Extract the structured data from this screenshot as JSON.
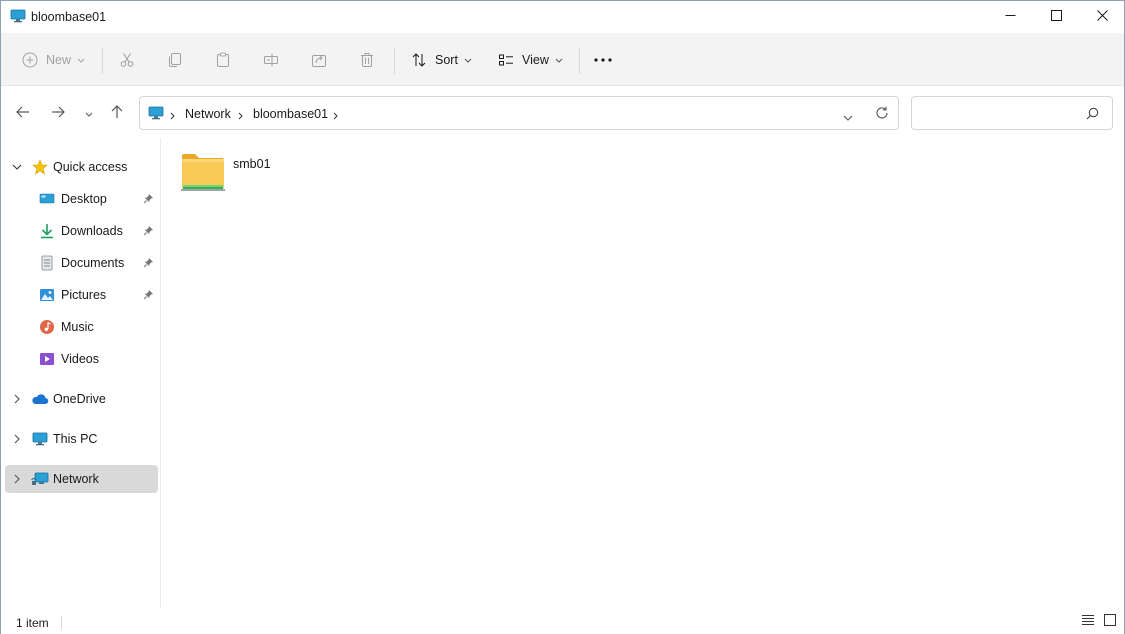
{
  "window": {
    "title": "bloombase01",
    "minimize_label": "Minimize",
    "maximize_label": "Maximize",
    "close_label": "Close"
  },
  "toolbar": {
    "new_label": "New",
    "sort_label": "Sort",
    "view_label": "View",
    "more_glyph": "···"
  },
  "address": {
    "breadcrumbs": [
      "Network",
      "bloombase01"
    ],
    "search_placeholder": ""
  },
  "sidebar": {
    "quick_access": "Quick access",
    "pinned": [
      {
        "label": "Desktop",
        "icon": "desktop-icon"
      },
      {
        "label": "Downloads",
        "icon": "downloads-icon"
      },
      {
        "label": "Documents",
        "icon": "documents-icon"
      },
      {
        "label": "Pictures",
        "icon": "pictures-icon"
      },
      {
        "label": "Music",
        "icon": "music-icon"
      },
      {
        "label": "Videos",
        "icon": "videos-icon"
      }
    ],
    "onedrive": "OneDrive",
    "this_pc": "This PC",
    "network": "Network"
  },
  "files": [
    {
      "name": "smb01",
      "icon": "network-share-folder-icon"
    }
  ],
  "status": {
    "item_count": "1 item"
  },
  "colors": {
    "accent": "#0067c0",
    "folder": "#f5c542",
    "selected": "#d9d9d9"
  }
}
